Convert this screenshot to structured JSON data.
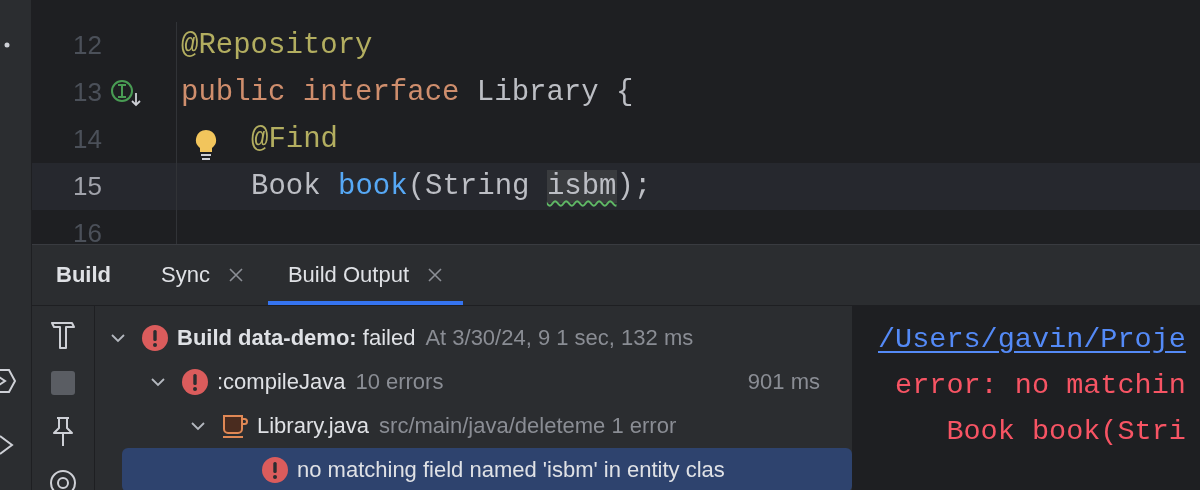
{
  "editor": {
    "lines": [
      {
        "number": "12",
        "current": false,
        "implemented": false,
        "hint": false,
        "indented": false,
        "tokens": [
          {
            "kind": "annotation",
            "text": "@Repository"
          }
        ]
      },
      {
        "number": "13",
        "current": false,
        "implemented": true,
        "hint": false,
        "indented": false,
        "tokens": [
          {
            "kind": "keyword",
            "text": "public interface "
          },
          {
            "kind": "plain",
            "text": "Library {"
          }
        ]
      },
      {
        "number": "14",
        "current": false,
        "implemented": false,
        "hint": true,
        "indented": true,
        "tokens": [
          {
            "kind": "annotation",
            "text": "@Find"
          }
        ]
      },
      {
        "number": "15",
        "current": true,
        "implemented": false,
        "hint": false,
        "indented": true,
        "tokens": [
          {
            "kind": "plain",
            "text": "Book "
          },
          {
            "kind": "method",
            "text": "book"
          },
          {
            "kind": "plain",
            "text": "(String "
          },
          {
            "kind": "warning",
            "text": "isbm"
          },
          {
            "kind": "plain",
            "text": ");"
          }
        ]
      },
      {
        "number": "16",
        "current": false,
        "implemented": false,
        "hint": false
      }
    ]
  },
  "tool_window": {
    "title": "Build",
    "tabs": [
      {
        "label": "Sync",
        "selected": false
      },
      {
        "label": "Build Output",
        "selected": true
      }
    ],
    "tree": [
      {
        "kind": "error",
        "label": "**Build data-demo:** failed",
        "detail": "At 3/30/24, 9 1 sec, 132 ms",
        "expanded": true,
        "selected": false,
        "children": [
          {
            "kind": "error",
            "label": ":compileJava",
            "detail": "10 errors",
            "time": "901 ms",
            "expanded": true,
            "selected": false,
            "children": [
              {
                "kind": "java-file",
                "label": "Library.java",
                "detail": "src/main/java/deleteme 1 error",
                "expanded": true,
                "selected": false,
                "children": [
                  {
                    "kind": "error",
                    "label": "no matching field named 'isbm' in entity clas",
                    "selected": true
                  }
                ]
              }
            ]
          }
        ]
      }
    ],
    "console": [
      {
        "kind": "link",
        "text": "/Users/gavin/Proje"
      },
      {
        "kind": "error",
        "text": " error: no matchin"
      },
      {
        "kind": "error",
        "text": "    Book book(Stri"
      }
    ]
  }
}
